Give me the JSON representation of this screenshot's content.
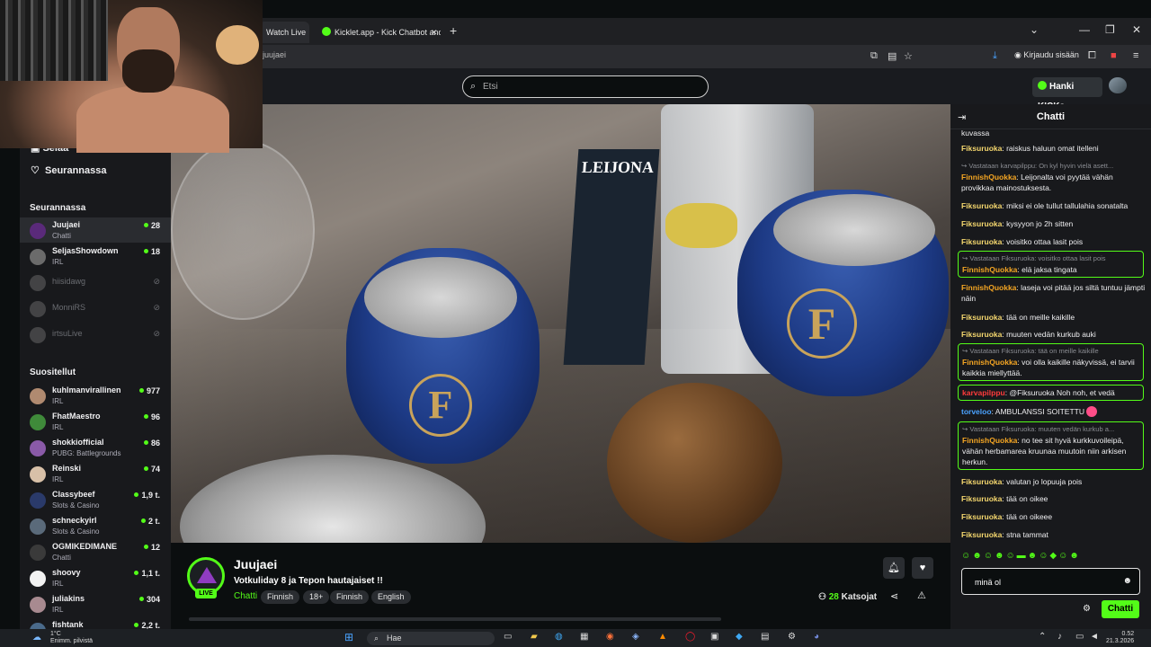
{
  "browser": {
    "tabs": [
      {
        "label": "Watch Live"
      },
      {
        "label": "Kicklet.app - Kick Chatbot and C"
      }
    ],
    "address": "juujaei",
    "signin_label": "Kirjaudu sisään"
  },
  "header": {
    "search_placeholder": "Etsi",
    "kicks_label": "Hanki KICKs"
  },
  "sidebar": {
    "nav": [
      {
        "label": "Selaa"
      },
      {
        "label": "Seurannassa"
      }
    ],
    "following_heading": "Seurannassa",
    "following": [
      {
        "name": "Juujaei",
        "category": "Chatti",
        "viewers": "28",
        "online": true
      },
      {
        "name": "SeljasShowdown",
        "category": "IRL",
        "viewers": "18",
        "online": true
      },
      {
        "name": "hiisidawg",
        "online": false
      },
      {
        "name": "MonniRS",
        "online": false
      },
      {
        "name": "irtsuLive",
        "online": false
      }
    ],
    "recommended_heading": "Suositellut",
    "recommended": [
      {
        "name": "kuhlmanvirallinen",
        "category": "IRL",
        "viewers": "977"
      },
      {
        "name": "FhatMaestro",
        "category": "IRL",
        "viewers": "96"
      },
      {
        "name": "shokkiofficial",
        "category": "PUBG: Battlegrounds",
        "viewers": "86"
      },
      {
        "name": "Reinski",
        "category": "IRL",
        "viewers": "74"
      },
      {
        "name": "Classybeef",
        "category": "Slots & Casino",
        "viewers": "1,9 t."
      },
      {
        "name": "schneckyirl",
        "category": "Slots & Casino",
        "viewers": "2 t."
      },
      {
        "name": "OGMIKEDIMANE",
        "category": "Chatti",
        "viewers": "12"
      },
      {
        "name": "shoovy",
        "category": "IRL",
        "viewers": "1,1 t."
      },
      {
        "name": "juliakins",
        "category": "IRL",
        "viewers": "304"
      },
      {
        "name": "fishtank",
        "category": "",
        "viewers": "2,2 t."
      }
    ]
  },
  "video": {
    "label_text": "LEIJONA"
  },
  "stream": {
    "live_label": "LIVE",
    "streamer": "Juujaei",
    "title": "Votkuliday 8 ja Tepon hautajaiset !!",
    "category": "Chatti",
    "tags": [
      "Finnish",
      "18+",
      "Finnish",
      "English"
    ],
    "viewer_count": "28",
    "viewer_label": "Katsojat"
  },
  "chat": {
    "title": "Chatti",
    "messages": [
      {
        "user": "",
        "text": "kuvassa"
      },
      {
        "user": "Fiksuruoka",
        "text": "raiskus haluun omat itelleni"
      },
      {
        "reply": "Vastataan karvapilppu: On kyl hyvin vielä asett...",
        "user": "FinnishQuokka",
        "text": "Leijonalta voi pyytää vähän provikkaa mainostuksesta."
      },
      {
        "user": "Fiksuruoka",
        "text": "miksi ei ole tullut tallulahia sonatalta"
      },
      {
        "user": "Fiksuruoka",
        "text": "kysyyon jo 2h sitten"
      },
      {
        "user": "Fiksuruoka",
        "text": "voisitko ottaa lasit pois"
      },
      {
        "reply": "Vastataan Fiksuruoka: voisitko ottaa lasit pois",
        "user": "FinnishQuokka",
        "text": "elä jaksa tingata"
      },
      {
        "user": "FinnishQuokka",
        "text": "laseja voi pitää jos siltä tuntuu jämpti näin"
      },
      {
        "user": "Fiksuruoka",
        "text": "tää on meille kaikille"
      },
      {
        "user": "Fiksuruoka",
        "text": "muuten vedän kurkub auki"
      },
      {
        "reply": "Vastataan Fiksuruoka: tää on meille kaikille",
        "user": "FinnishQuokka",
        "text": "voi olla kaikille näkyvissä, ei tarvii kaikkia miellyttää."
      },
      {
        "user": "karvapilppu",
        "text": "@Fiksuruoka Noh noh, et vedä"
      },
      {
        "user": "torveloo",
        "text": "AMBULANSSI SOITETTU"
      },
      {
        "reply": "Vastataan Fiksuruoka: muuten vedän kurkub a...",
        "user": "FinnishQuokka",
        "text": "no tee sit hyvä kurkkuvoileipä, vähän herbamarea kruunaa muutoin niin arkisen herkun."
      },
      {
        "user": "Fiksuruoka",
        "text": "valutan jo lopuuja pois"
      },
      {
        "user": "Fiksuruoka",
        "text": "tää on oikee"
      },
      {
        "user": "Fiksuruoka",
        "text": "tää on oikeee"
      },
      {
        "user": "Fiksuruoka",
        "text": "stna tammat"
      }
    ],
    "input_value": "minä ol",
    "send_label": "Chatti"
  },
  "taskbar": {
    "weather_temp": "1°C",
    "weather_desc": "Enimm. pilvistä",
    "search_label": "Hae",
    "time": "0.52",
    "date": "21.3.2026"
  },
  "colors": {
    "brand_green": "#53fc18",
    "quokka_orange": "#f5a623",
    "fiksu_yellow": "#f5d76e",
    "karva_red": "#ff3b3b",
    "torveloo_blue": "#4aa3ff"
  }
}
